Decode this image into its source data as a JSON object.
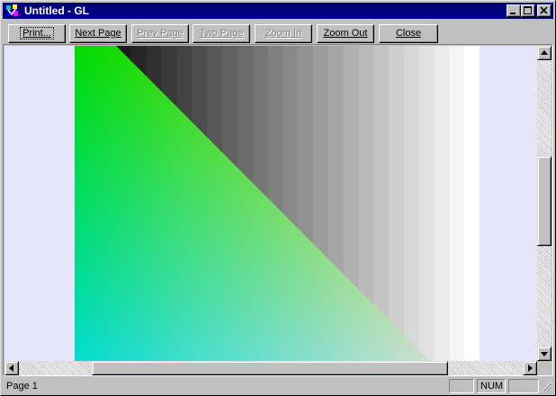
{
  "window": {
    "title": "Untitled - GL"
  },
  "toolbar": {
    "buttons": [
      {
        "id": "print",
        "label": "Print...",
        "enabled": true,
        "focused": true
      },
      {
        "id": "next-page",
        "label": "Next Page",
        "enabled": true
      },
      {
        "id": "prev-page",
        "label": "Prev Page",
        "enabled": false
      },
      {
        "id": "two-page",
        "label": "Two Page",
        "enabled": false
      },
      {
        "id": "zoom-in",
        "label": "Zoom In",
        "enabled": false
      },
      {
        "id": "zoom-out",
        "label": "Zoom Out",
        "enabled": true
      },
      {
        "id": "close",
        "label": "Close",
        "enabled": true
      }
    ]
  },
  "preview": {
    "background_color": "#e6e6fa",
    "page_color": "#ffffff",
    "gradient_corners": {
      "top_left": "#00ee00",
      "bottom_left": "#0018e0",
      "bottom_right": "#e02000"
    },
    "gray_ramp": {
      "from": "#000000",
      "to": "#ffffff",
      "steps": 24
    }
  },
  "statusbar": {
    "text": "Page 1",
    "indicators": [
      "",
      "NUM",
      ""
    ]
  },
  "icons": {
    "app": "gl-app-icon",
    "minimize": "minimize-icon",
    "maximize": "maximize-icon",
    "close": "close-icon"
  }
}
